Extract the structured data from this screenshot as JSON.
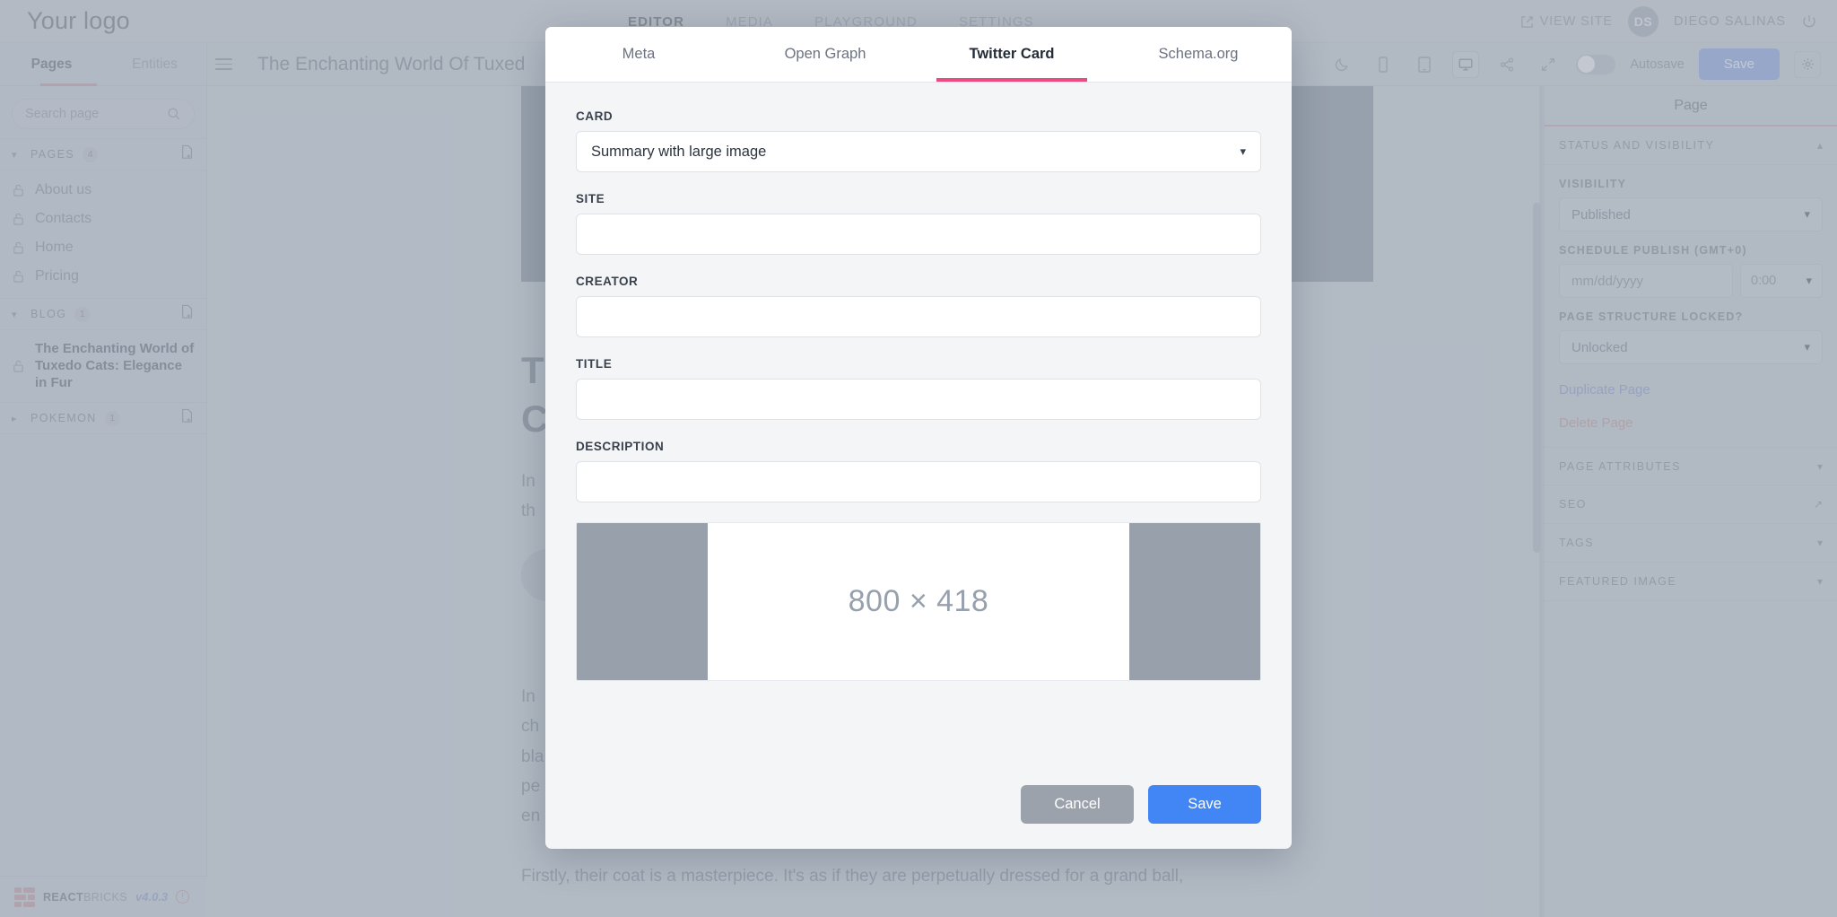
{
  "topbar": {
    "logo": "Your logo",
    "nav": [
      {
        "label": "EDITOR",
        "active": true
      },
      {
        "label": "MEDIA",
        "active": false
      },
      {
        "label": "PLAYGROUND",
        "active": false
      },
      {
        "label": "SETTINGS",
        "active": false
      }
    ],
    "view_site": "VIEW SITE",
    "avatar_initials": "DS",
    "user_name": "DIEGO SALINAS"
  },
  "secondbar": {
    "doc_title": "The Enchanting World Of Tuxed",
    "autosave_label": "Autosave",
    "save_label": "Save"
  },
  "sidebar": {
    "tabs": [
      {
        "label": "Pages",
        "active": true
      },
      {
        "label": "Entities",
        "active": false
      }
    ],
    "search_placeholder": "Search page",
    "sections": [
      {
        "name": "PAGES",
        "count": "4",
        "expanded": true
      },
      {
        "name": "BLOG",
        "count": "1",
        "expanded": true
      },
      {
        "name": "POKEMON",
        "count": "1",
        "expanded": false
      }
    ],
    "pages": [
      "About us",
      "Contacts",
      "Home",
      "Pricing"
    ],
    "blog_post": "The Enchanting World of Tuxedo Cats: Elegance in Fur"
  },
  "footer": {
    "brand_bold": "REACT",
    "brand_light": "BRICKS",
    "version": "v4.0.3"
  },
  "canvas": {
    "heading": "T\nC",
    "para1": "In\nth",
    "para2": "In\nch\nbla\npe\nen",
    "para3": "Firstly, their coat is a masterpiece. It's as if they are perpetually dressed for a grand ball,"
  },
  "rightpanel": {
    "title": "Page",
    "status_section": "STATUS AND VISIBILITY",
    "visibility_label": "VISIBILITY",
    "visibility_value": "Published",
    "schedule_label": "SCHEDULE PUBLISH (GMT+0)",
    "date_placeholder": "mm/dd/yyyy",
    "time_value": "0:00",
    "locked_label": "PAGE STRUCTURE LOCKED?",
    "locked_value": "Unlocked",
    "duplicate_page": "Duplicate Page",
    "delete_page": "Delete Page",
    "sections": [
      {
        "label": "PAGE ATTRIBUTES",
        "icon": "chevron-down"
      },
      {
        "label": "SEO",
        "icon": "external-link"
      },
      {
        "label": "TAGS",
        "icon": "chevron-down"
      },
      {
        "label": "FEATURED IMAGE",
        "icon": "chevron-down"
      }
    ]
  },
  "modal": {
    "tabs": [
      {
        "label": "Meta",
        "active": false
      },
      {
        "label": "Open Graph",
        "active": false
      },
      {
        "label": "Twitter Card",
        "active": true
      },
      {
        "label": "Schema.org",
        "active": false
      }
    ],
    "accent_color": "#ec4a84",
    "fields": [
      {
        "label": "CARD",
        "value": "Summary with large image",
        "type": "select"
      },
      {
        "label": "SITE",
        "value": "",
        "type": "text"
      },
      {
        "label": "CREATOR",
        "value": "",
        "type": "text"
      },
      {
        "label": "TITLE",
        "value": "",
        "type": "text"
      },
      {
        "label": "DESCRIPTION",
        "value": "",
        "type": "text"
      }
    ],
    "image_placeholder": "800 × 418",
    "cancel_label": "Cancel",
    "save_label": "Save"
  }
}
